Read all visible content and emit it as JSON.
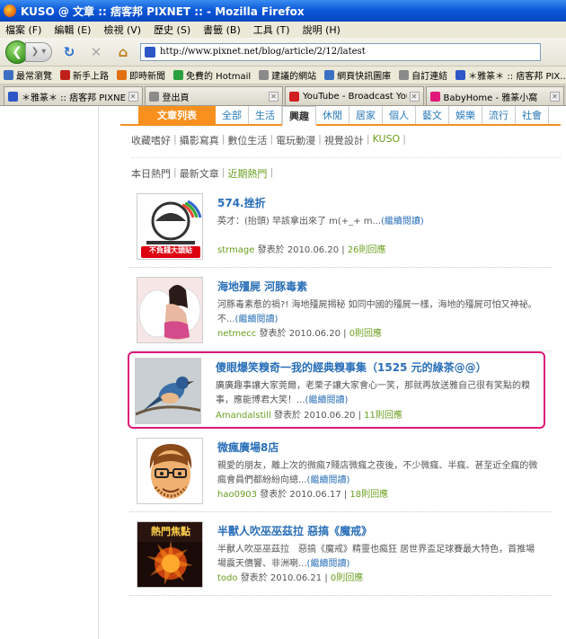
{
  "window": {
    "title": "KUSO @ 文章 :: 痞客邦 PIXNET :: - Mozilla Firefox"
  },
  "menu": [
    "檔案 (F)",
    "編輯 (E)",
    "檢視 (V)",
    "歷史 (S)",
    "書籤 (B)",
    "工具 (T)",
    "說明 (H)"
  ],
  "nav": {
    "url": "http://www.pixnet.net/blog/article/2/12/latest"
  },
  "bookmarks": [
    {
      "label": "最常瀏覽",
      "color": "#3b6fc2"
    },
    {
      "label": "新手上路",
      "color": "#c0201a"
    },
    {
      "label": "即時新聞",
      "color": "#e07010"
    },
    {
      "label": "免費的 Hotmail",
      "color": "#2aa040"
    },
    {
      "label": "建議的網站",
      "color": "#8a8a8a"
    },
    {
      "label": "網頁快訊圖庫",
      "color": "#3b6fc2"
    },
    {
      "label": "自訂連結",
      "color": "#8a8a8a"
    },
    {
      "label": "＊雅篆＊ :: 痞客邦 PIX…",
      "color": "#2d56c9"
    }
  ],
  "tabs": [
    {
      "label": "＊雅篆＊ :: 痞客邦 PIXNET ::",
      "color": "#2d56c9",
      "active": false
    },
    {
      "label": "登出頁",
      "color": "#8a8a8a",
      "active": false
    },
    {
      "label": "YouTube - Broadcast Yourse…",
      "color": "#d21e1e",
      "active": false
    },
    {
      "label": "BabyHome - 雅篆小窩",
      "color": "#e0187a",
      "active": false
    }
  ],
  "category": {
    "heading": "文章列表",
    "items": [
      "全部",
      "生活",
      "興趣",
      "休閒",
      "居家",
      "個人",
      "藝文",
      "娛樂",
      "流行",
      "社會"
    ],
    "selected": 2
  },
  "subcategories": [
    "收藏嗜好",
    "攝影寫真",
    "數位生活",
    "電玩動漫",
    "視覺設計",
    "KUSO"
  ],
  "subcategory_selected": 5,
  "sort_tabs": [
    "本日熱門",
    "最新文章",
    "近期熱門"
  ],
  "sort_selected": 2,
  "posts": [
    {
      "title": "574.挫折",
      "excerpt": "英才：(抬頭) 早該拿出來了 m(+_+ m...",
      "more": "(繼續閱讀)",
      "author": "strmage",
      "posted_prefix": "發表於",
      "date": "2010.06.20",
      "replies": "26則回應",
      "thumb_caption": "不負錢大頭貼",
      "highlighted": false
    },
    {
      "title": "海地殭屍 河豚毒素",
      "excerpt": "河豚毒素惹的禍?! 海地殭屍揭秘 如同中國的殭屍一樣，海地的殭屍可怕又神祕。不...",
      "more": "(繼續閱讀)",
      "author": "netmecc",
      "posted_prefix": "發表於",
      "date": "2010.06.20",
      "replies": "0則回應",
      "highlighted": false
    },
    {
      "title": "傻眼爆笑糗奇一我的經典糗事集（1525 元的綠茶@@）",
      "excerpt": "廣廣趣事讓大家莞爾，老栗子讓大家會心一笑，那就再放送雅自己很有笑點的糗事，應能博君大笑！...",
      "more": "(繼續閱讀)",
      "author": "Amandalstill",
      "posted_prefix": "發表於",
      "date": "2010.06.20",
      "replies": "11則回應",
      "highlighted": true
    },
    {
      "title": "微瘋廣場8店",
      "excerpt": "親愛的朋友，離上次的微瘋7賤店微瘋之夜後，不少微瘋、半瘋、甚至近全瘋的微瘋會員們都紛紛向總...",
      "more": "(繼續閱讀)",
      "author": "hao0903",
      "posted_prefix": "發表於",
      "date": "2010.06.17",
      "replies": "18則回應",
      "highlighted": false
    },
    {
      "title": "半獸人吹巫巫茲拉 惡搞《魔戒》",
      "excerpt": "半獸人吹巫巫茲拉　惡搞《魔戒》精靈也瘋狂 居世界盃足球賽最大特色，首推場場震天價響、非洲喇...",
      "more": "(繼續閱讀)",
      "author": "todo",
      "posted_prefix": "發表於",
      "date": "2010.06.21",
      "replies": "0則回應",
      "thumb_caption": "熱門焦點",
      "highlighted": false
    }
  ],
  "colors": {
    "accent": "#f7901e",
    "link": "#2a6fb8",
    "highlight": "#e0187a",
    "green": "#6a9f1e"
  }
}
